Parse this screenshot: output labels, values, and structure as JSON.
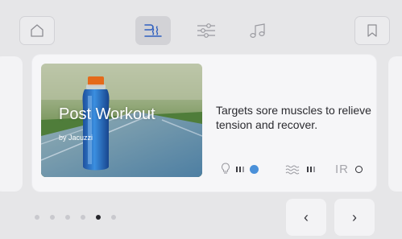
{
  "header": {
    "tabs": [
      {
        "icon": "jets-icon",
        "active": true
      },
      {
        "icon": "settings-sliders-icon",
        "active": false
      },
      {
        "icon": "music-icon",
        "active": false
      }
    ],
    "home_icon": "home-icon",
    "bookmark_icon": "bookmark-icon"
  },
  "program": {
    "title": "Post Workout",
    "brand": "by Jacuzzi",
    "description": "Targets sore muscles to relieve tension and recover.",
    "features": [
      {
        "icon": "light-bulb-icon",
        "level_icon": "bars-icon",
        "status": "on"
      },
      {
        "icon": "jets-wave-icon",
        "level_icon": "bars-icon"
      },
      {
        "label": "IR",
        "status": "off"
      }
    ]
  },
  "pagination": {
    "total": 6,
    "current": 5
  },
  "nav": {
    "prev": "‹",
    "next": "›"
  },
  "colors": {
    "accent": "#4a90d9",
    "background": "#e6e6e8",
    "card": "#f6f6f8"
  }
}
